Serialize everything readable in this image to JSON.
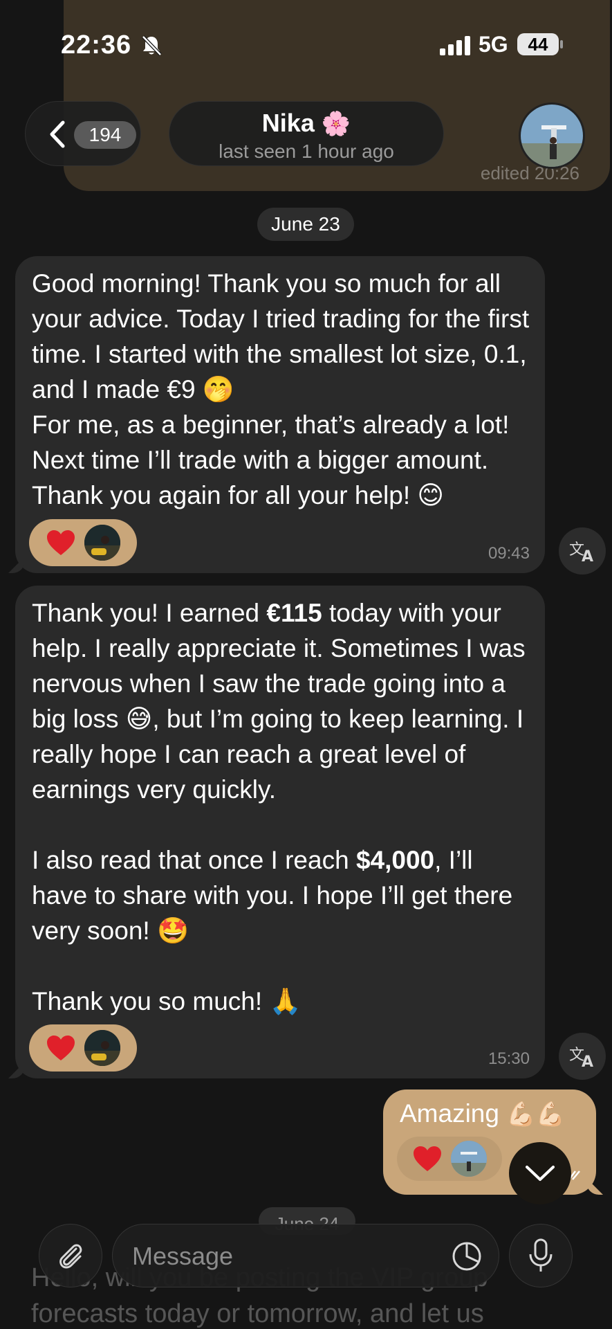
{
  "status_bar": {
    "time": "22:36",
    "network": "5G",
    "battery": "44",
    "icons": [
      "bell-off-icon",
      "signal-icon",
      "battery-icon"
    ]
  },
  "header": {
    "back_count": "194",
    "contact_name": "Nika",
    "contact_emoji": "🌸",
    "last_seen": "last seen 1 hour ago"
  },
  "ghost_top": {
    "edited_label": "edited 20:26"
  },
  "date_chip": "June 23",
  "messages": [
    {
      "direction": "incoming",
      "text_parts": [
        "Good morning! Thank you so much for all your advice. Today I tried trading for the first time. I started with the smallest lot size, 0.1, and I made €9 ",
        "🤭",
        "\nFor me, as a beginner, that’s already a lot! Next time I’ll trade with a bigger amount. Thank you again for all your help! ",
        "😊"
      ],
      "reaction": "❤️",
      "time": "09:43"
    },
    {
      "direction": "incoming",
      "text_parts": [
        "Thank you! I earned ",
        "€115",
        " today with your help. I really appreciate it. Sometimes I was nervous when I saw the trade going into a big loss ",
        "😅",
        ", but I’m going to keep learning. I really hope I can reach a great level of earnings very quickly.\n\nI also read that once I reach ",
        "$4,000",
        ", I’ll have to share with you. I hope I’ll get there very soon! ",
        "🤩",
        "\n\nThank you so much! ",
        "🙏"
      ],
      "reaction": "❤️",
      "time": "15:30"
    },
    {
      "direction": "outgoing",
      "text": "Amazing",
      "emoji": "💪🏻💪🏻",
      "reaction": "❤️"
    }
  ],
  "next_date_chip": "June 24",
  "next_message_preview": "Hello, will you be posting the VIP group forecasts today or tomorrow, and let us",
  "composer": {
    "placeholder": "Message"
  },
  "colors": {
    "background": "#151515",
    "incoming_bubble": "#2a2a2a",
    "outgoing_bubble": "#c9a67a",
    "reaction_heart": "#e0202a"
  }
}
